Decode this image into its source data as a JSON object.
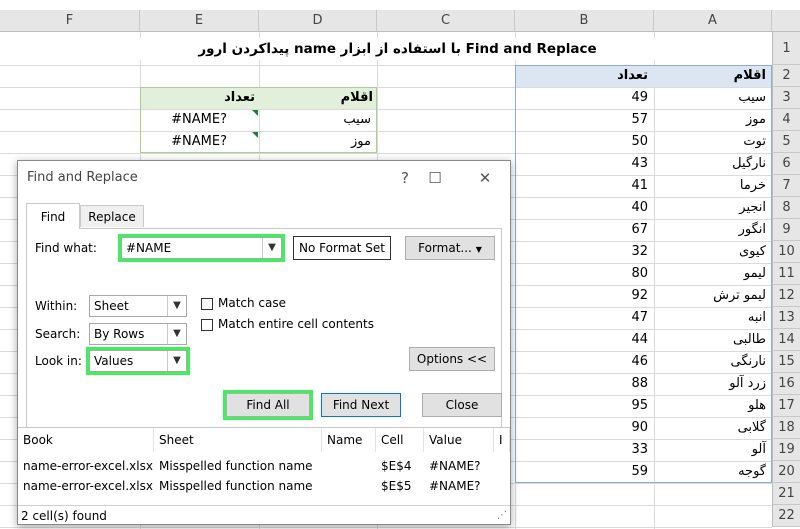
{
  "columns": [
    "F",
    "E",
    "D",
    "C",
    "B",
    "A"
  ],
  "rows": [
    "1",
    "2",
    "3",
    "4",
    "5",
    "6",
    "7",
    "8",
    "9",
    "10",
    "11",
    "12",
    "13",
    "14",
    "15",
    "16",
    "17",
    "18",
    "19",
    "20",
    "21",
    "22"
  ],
  "sheet_title": "پیداکردن ارور name با استفاده از ابزار Find and Replace",
  "table_main": {
    "header_items": "اقلام",
    "header_count": "تعداد",
    "rows": [
      {
        "item": "سیب",
        "count": "49"
      },
      {
        "item": "موز",
        "count": "57"
      },
      {
        "item": "توت",
        "count": "50"
      },
      {
        "item": "نارگیل",
        "count": "43"
      },
      {
        "item": "خرما",
        "count": "41"
      },
      {
        "item": "انجیر",
        "count": "40"
      },
      {
        "item": "انگور",
        "count": "67"
      },
      {
        "item": "کیوی",
        "count": "32"
      },
      {
        "item": "لیمو",
        "count": "80"
      },
      {
        "item": "لیمو ترش",
        "count": "92"
      },
      {
        "item": "انبه",
        "count": "47"
      },
      {
        "item": "طالبی",
        "count": "44"
      },
      {
        "item": "نارنگی",
        "count": "46"
      },
      {
        "item": "زرد آلو",
        "count": "88"
      },
      {
        "item": "هلو",
        "count": "95"
      },
      {
        "item": "گلابی",
        "count": "90"
      },
      {
        "item": "آلو",
        "count": "33"
      },
      {
        "item": "گوجه",
        "count": "59"
      }
    ]
  },
  "table_small": {
    "header_items": "اقلام",
    "header_count": "تعداد",
    "rows": [
      {
        "item": "سیب",
        "count": "#NAME?"
      },
      {
        "item": "موز",
        "count": "#NAME?"
      }
    ]
  },
  "dialog": {
    "title": "Find and Replace",
    "tabs": {
      "find": "Find",
      "replace": "Replace"
    },
    "find_what_label": "Find what:",
    "find_what_value": "#NAME",
    "no_format": "No Format Set",
    "format_btn": "Format...",
    "within_label": "Within:",
    "within_value": "Sheet",
    "search_label": "Search:",
    "search_value": "By Rows",
    "lookin_label": "Look in:",
    "lookin_value": "Values",
    "match_case": "Match case",
    "match_entire": "Match entire cell contents",
    "options_btn": "Options <<",
    "find_all": "Find All",
    "find_next": "Find Next",
    "close": "Close",
    "result_headers": [
      "Book",
      "Sheet",
      "Name",
      "Cell",
      "Value",
      "I"
    ],
    "results": [
      {
        "book": "name-error-excel.xlsx",
        "sheet": "Misspelled function name",
        "name": "",
        "cell": "$E$4",
        "value": "#NAME?"
      },
      {
        "book": "name-error-excel.xlsx",
        "sheet": "Misspelled function name",
        "name": "",
        "cell": "$E$5",
        "value": "#NAME?"
      }
    ],
    "status": "2 cell(s) found"
  },
  "colors": {
    "header_blue": "#dce6f2",
    "header_green": "#e2efda",
    "highlight": "#3ef05a"
  }
}
